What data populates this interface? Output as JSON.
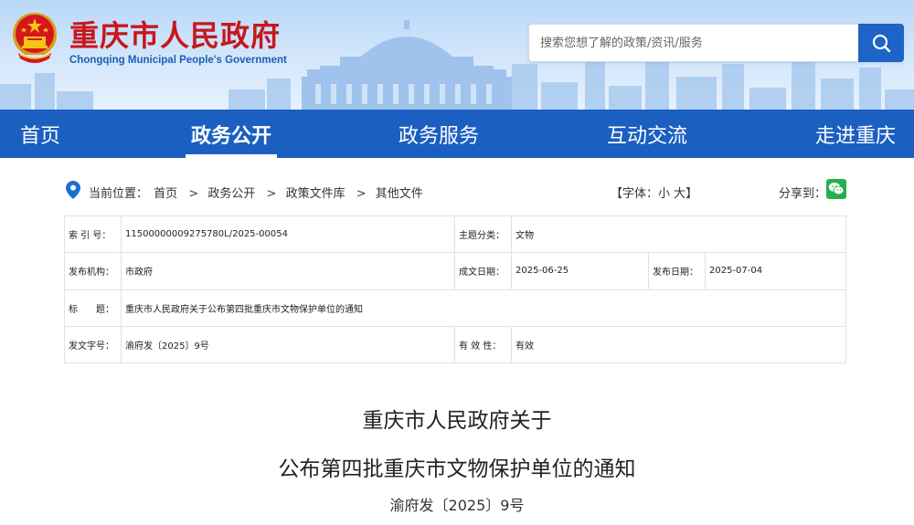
{
  "header": {
    "site_name": "重庆市人民政府",
    "site_name_en": "Chongqing Municipal People's Government",
    "search_placeholder": "搜索您想了解的政策/资讯/服务"
  },
  "nav": {
    "items": [
      {
        "label": "首页"
      },
      {
        "label": "政务公开"
      },
      {
        "label": "政务服务"
      },
      {
        "label": "互动交流"
      },
      {
        "label": "走进重庆"
      }
    ],
    "active_index": 1
  },
  "breadcrumb": {
    "prefix": "当前位置：",
    "items": [
      "首页",
      "政务公开",
      "政策文件库",
      "其他文件"
    ],
    "separator": ">"
  },
  "font_size": {
    "open": "【字体：",
    "small": "小",
    "large": "大",
    "close": "】"
  },
  "share": {
    "label": "分享到："
  },
  "info": {
    "index_label": "索 引 号：",
    "index_value": "11500000009275780L/2025-00054",
    "topic_label": "主题分类：",
    "topic_value": "文物",
    "publisher_label": "发布机构：",
    "publisher_value": "市政府",
    "written_label": "成文日期：",
    "written_value": "2025-06-25",
    "published_label": "发布日期：",
    "published_value": "2025-07-04",
    "title_label": "标　　题：",
    "title_value": "重庆市人民政府关于公布第四批重庆市文物保护单位的通知",
    "docno_label": "发文字号：",
    "docno_value": "渝府发〔2025〕9号",
    "validity_label": "有 效 性：",
    "validity_value": "有效"
  },
  "document": {
    "title_line1": "重庆市人民政府关于",
    "title_line2": "公布第四批重庆市文物保护单位的通知",
    "number": "渝府发〔2025〕9号"
  },
  "colors": {
    "brand_red": "#c8161d",
    "nav_blue": "#1b5fc1",
    "search_blue": "#1e63c6",
    "wechat_green": "#22b14c"
  }
}
